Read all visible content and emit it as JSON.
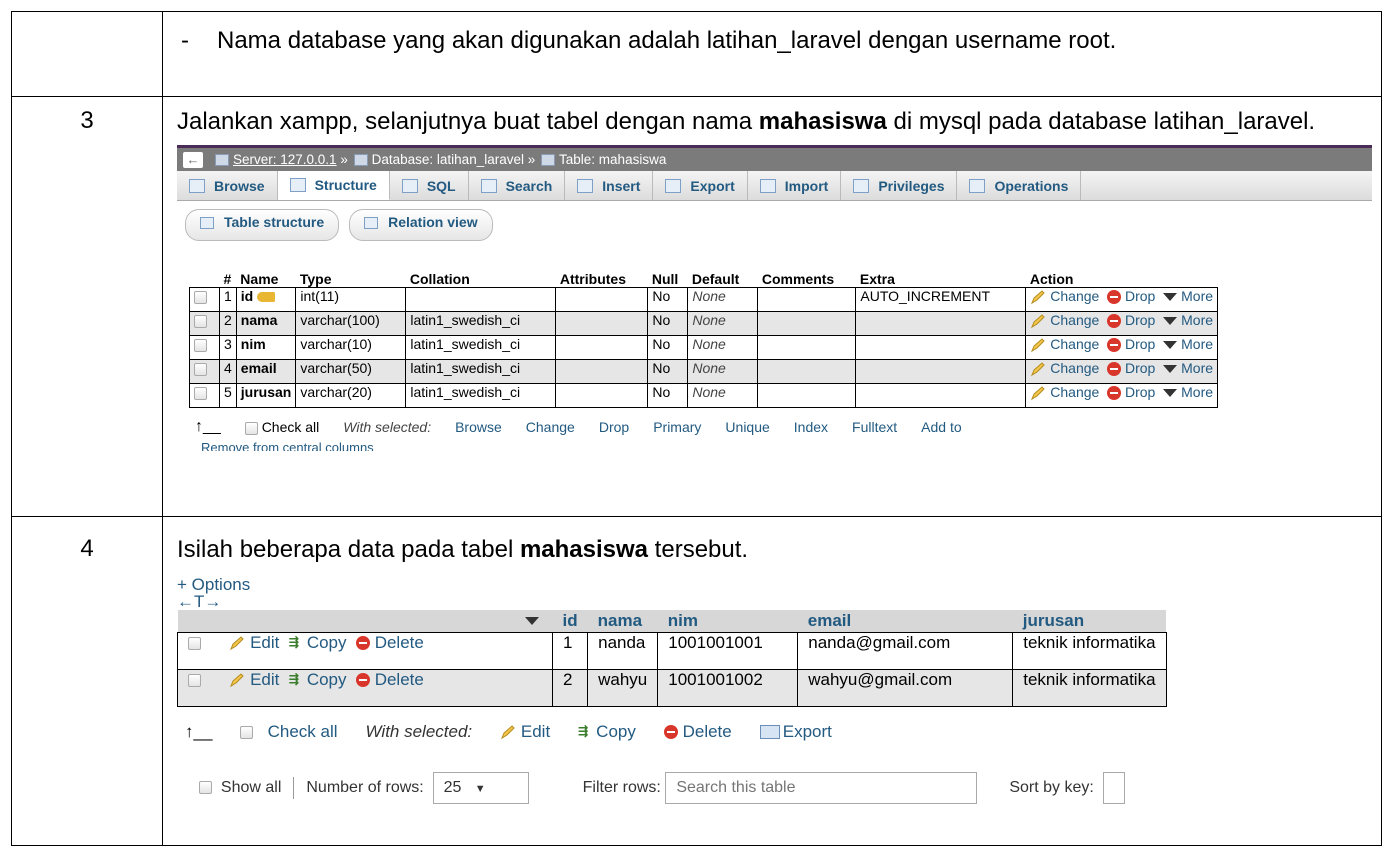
{
  "rows": [
    {
      "num": "",
      "text": "Nama database yang akan digunakan adalah latihan_laravel dengan username root.",
      "bullet": "-"
    },
    {
      "num": "3",
      "text_before": "Jalankan xampp, selanjutnya buat tabel dengan nama ",
      "bold": "mahasiswa",
      "text_after": " di mysql pada database latihan_laravel."
    },
    {
      "num": "4",
      "text_before": "Isilah beberapa data pada tabel ",
      "bold": "mahasiswa",
      "text_after": " tersebut."
    }
  ],
  "pma_structure": {
    "breadcrumb": {
      "back": "←",
      "server": "Server: 127.0.0.1",
      "sep": "»",
      "database": "Database: latihan_laravel",
      "table": "Table: mahasiswa"
    },
    "tabs": [
      "Browse",
      "Structure",
      "SQL",
      "Search",
      "Insert",
      "Export",
      "Import",
      "Privileges",
      "Operations"
    ],
    "active_tab": "Structure",
    "subtabs": [
      "Table structure",
      "Relation view"
    ],
    "columns": [
      "#",
      "Name",
      "Type",
      "Collation",
      "Attributes",
      "Null",
      "Default",
      "Comments",
      "Extra",
      "Action"
    ],
    "rows": [
      {
        "num": "1",
        "name": "id",
        "type": "int(11)",
        "collation": "",
        "null": "No",
        "default": "None",
        "extra": "AUTO_INCREMENT"
      },
      {
        "num": "2",
        "name": "nama",
        "type": "varchar(100)",
        "collation": "latin1_swedish_ci",
        "null": "No",
        "default": "None",
        "extra": ""
      },
      {
        "num": "3",
        "name": "nim",
        "type": "varchar(10)",
        "collation": "latin1_swedish_ci",
        "null": "No",
        "default": "None",
        "extra": ""
      },
      {
        "num": "4",
        "name": "email",
        "type": "varchar(50)",
        "collation": "latin1_swedish_ci",
        "null": "No",
        "default": "None",
        "extra": ""
      },
      {
        "num": "5",
        "name": "jurusan",
        "type": "varchar(20)",
        "collation": "latin1_swedish_ci",
        "null": "No",
        "default": "None",
        "extra": ""
      }
    ],
    "actions": {
      "change": "Change",
      "drop": "Drop",
      "more": "More"
    },
    "footer": {
      "check_all": "Check all",
      "with_selected": "With selected:",
      "browse": "Browse",
      "change": "Change",
      "drop": "Drop",
      "primary": "Primary",
      "unique": "Unique",
      "index": "Index",
      "fulltext": "Fulltext",
      "add_to": "Add to",
      "remove": "Remove from central columns"
    }
  },
  "pma_browse": {
    "options": "+ Options",
    "arrows": "←T→",
    "columns": [
      "id",
      "nama",
      "nim",
      "email",
      "jurusan"
    ],
    "rows": [
      {
        "id": "1",
        "nama": "nanda",
        "nim": "1001001001",
        "email": "nanda@gmail.com",
        "jurusan": "teknik informatika"
      },
      {
        "id": "2",
        "nama": "wahyu",
        "nim": "1001001002",
        "email": "wahyu@gmail.com",
        "jurusan": "teknik informatika"
      }
    ],
    "row_actions": {
      "edit": "Edit",
      "copy": "Copy",
      "delete": "Delete"
    },
    "bottom": {
      "check_all": "Check all",
      "with_selected": "With selected:",
      "edit": "Edit",
      "copy": "Copy",
      "delete": "Delete",
      "export": "Export"
    },
    "filter": {
      "show_all": "Show all",
      "number_of_rows": "Number of rows:",
      "rows_value": "25",
      "filter_rows": "Filter rows:",
      "search_placeholder": "Search this table",
      "sort_by_key": "Sort by key:"
    }
  }
}
